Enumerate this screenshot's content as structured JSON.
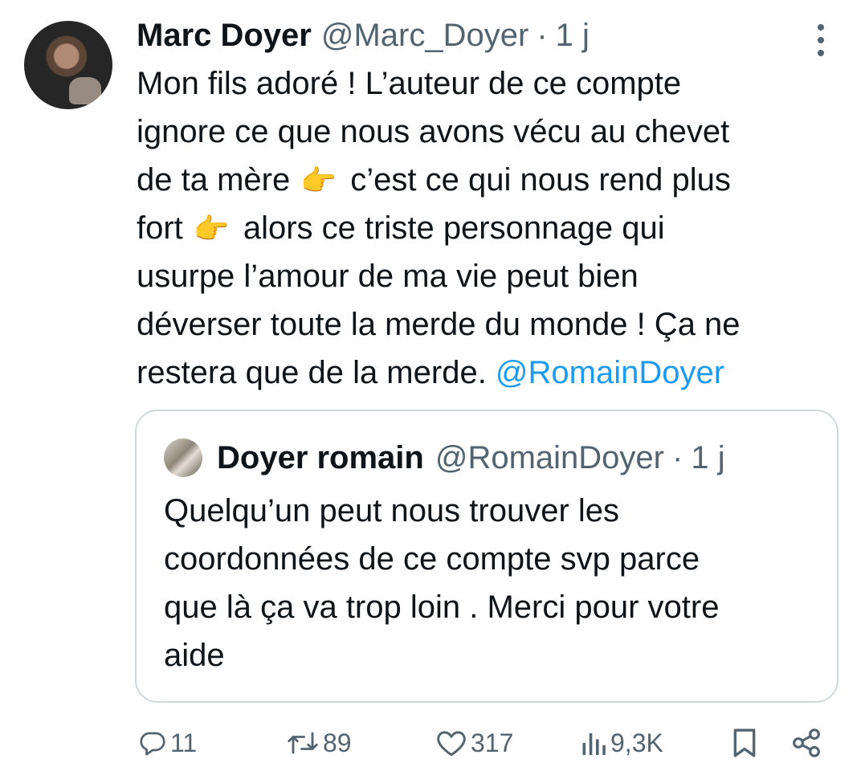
{
  "tweet": {
    "author": {
      "name": "Marc Doyer",
      "handle": "@Marc_Doyer",
      "time": "1 j"
    },
    "separator": "·",
    "text_lines": [
      "Mon fils adoré ! L’auteur de ce compte",
      "ignore ce que nous avons vécu au chevet",
      {
        "before": "de ta mère ",
        "emoji": "👉",
        "after": " c’est ce qui nous rend plus"
      },
      {
        "before": "fort ",
        "emoji": "👉",
        "after": " alors ce triste personnage qui"
      },
      "usurpe l’amour de ma vie peut bien",
      "déverser toute la merde du monde ! Ça ne",
      {
        "before": "restera que de la merde. ",
        "mention": "@RomainDoyer"
      }
    ]
  },
  "quote": {
    "author": {
      "name": "Doyer romain",
      "handle": "@RomainDoyer",
      "time": "1 j"
    },
    "separator": "·",
    "text_lines": [
      "Quelqu’un peut nous trouver les",
      "coordonnées de ce compte svp parce",
      "que là ça va trop loin . Merci pour votre",
      "aide"
    ]
  },
  "actions": {
    "replies": "11",
    "retweets": "89",
    "likes": "317",
    "views": "9,3K"
  },
  "colors": {
    "text": "#0f1419",
    "secondary": "#536471",
    "link": "#1d9bf0",
    "border": "#cfd9de"
  }
}
